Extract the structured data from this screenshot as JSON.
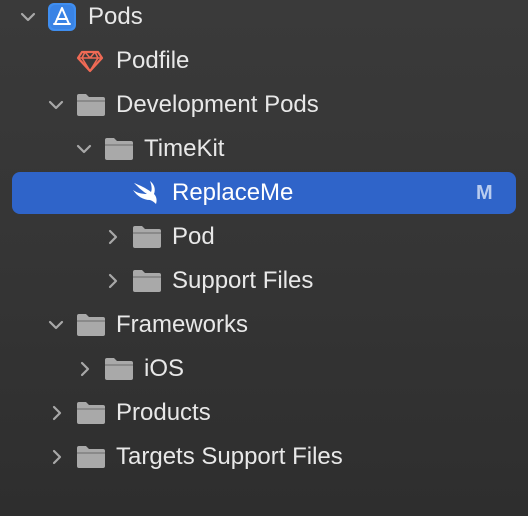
{
  "navigator": {
    "items": [
      {
        "label": "Pods",
        "icon": "xcode-project-icon",
        "expanded": true
      },
      {
        "label": "Podfile",
        "icon": "ruby-gem-icon"
      },
      {
        "label": "Development Pods",
        "icon": "folder-icon",
        "expanded": true
      },
      {
        "label": "TimeKit",
        "icon": "folder-icon",
        "expanded": true
      },
      {
        "label": "ReplaceMe",
        "icon": "swift-icon",
        "selected": true,
        "badge": "M"
      },
      {
        "label": "Pod",
        "icon": "folder-icon",
        "expanded": false
      },
      {
        "label": "Support Files",
        "icon": "folder-icon",
        "expanded": false
      },
      {
        "label": "Frameworks",
        "icon": "folder-icon",
        "expanded": true
      },
      {
        "label": "iOS",
        "icon": "folder-icon",
        "expanded": false
      },
      {
        "label": "Products",
        "icon": "folder-icon",
        "expanded": false
      },
      {
        "label": "Targets Support Files",
        "icon": "folder-icon",
        "expanded": false
      }
    ]
  },
  "colors": {
    "background": "#353535",
    "selection": "#2f64c9",
    "folder": "#a9a9a9",
    "project": "#3f8ef0",
    "ruby": "#f06a55"
  }
}
